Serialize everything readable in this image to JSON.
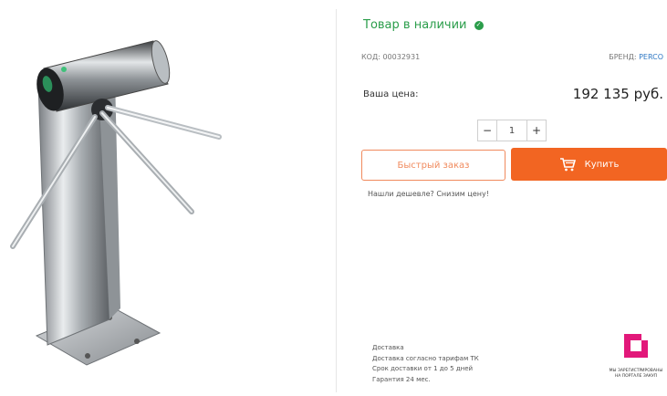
{
  "product": {
    "image_alt": "Турникет-трипод PERCO",
    "stock_status": "Товар в наличии",
    "code_label": "КОД: 00032931",
    "brand_label": "БРЕНД:",
    "brand_name": "PERCO",
    "price_label": "Ваша цена:",
    "price_value": "192 135 руб."
  },
  "quantity": {
    "minus": "−",
    "value": "1",
    "plus": "+"
  },
  "actions": {
    "quick_order": "Быстрый заказ",
    "buy": "Купить",
    "cheaper_link": "Нашли дешевле? Снизим цену!"
  },
  "delivery": {
    "title": "Доставка",
    "line1": "Доставка согласно тарифам ТК",
    "line2": "Срок доставки от 1 до 5 дней",
    "warranty": "Гарантия 24 мес."
  },
  "badge": {
    "line1": "МЫ ЗАРЕГИСТРИРОВАНЫ",
    "line2": "НА ПОРТАЛЕ ЗАКУП"
  },
  "colors": {
    "accent": "#f26522",
    "stock": "#2a9d4a",
    "brand_link": "#2f78c4",
    "badge": "#e2187a"
  }
}
